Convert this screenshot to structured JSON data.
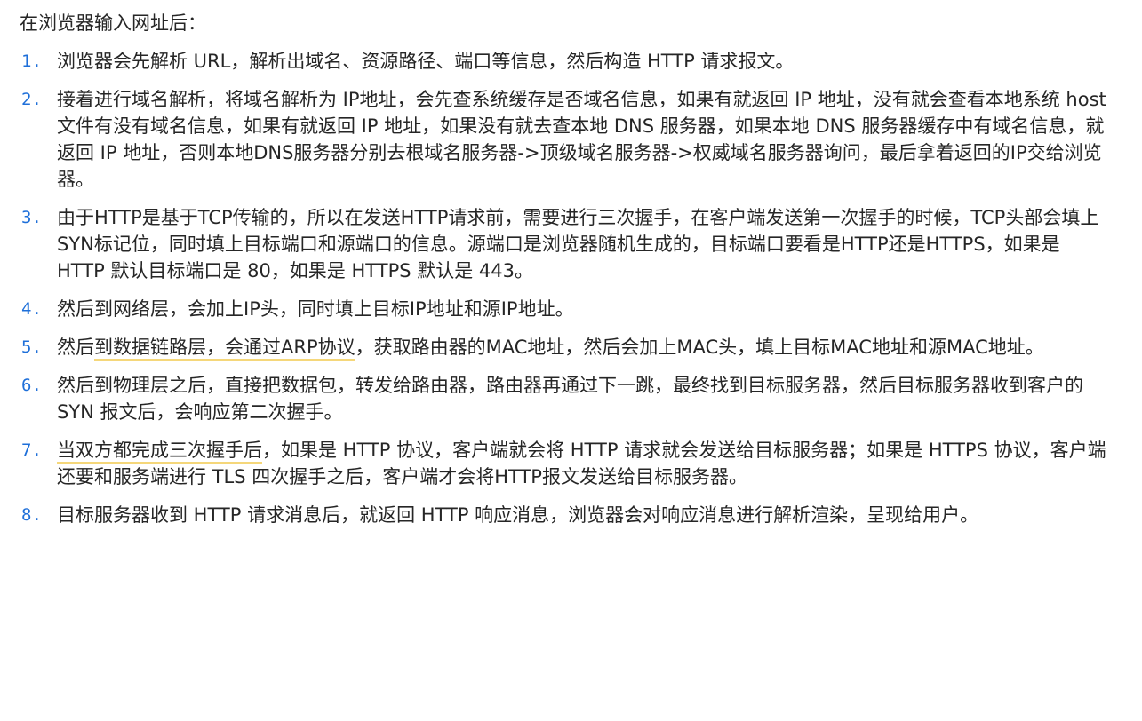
{
  "intro": "在浏览器输入网址后：",
  "steps": [
    {
      "number": "1.",
      "pre": "",
      "highlight": "",
      "text": "浏览器会先解析 URL，解析出域名、资源路径、端口等信息，然后构造 HTTP 请求报文。"
    },
    {
      "number": "2.",
      "pre": "",
      "highlight": "",
      "text": "接着进行域名解析，将域名解析为 IP地址，会先查系统缓存是否域名信息，如果有就返回 IP 地址，没有就会查看本地系统 host 文件有没有域名信息，如果有就返回 IP 地址，如果没有就去查本地 DNS 服务器，如果本地 DNS 服务器缓存中有域名信息，就返回 IP 地址，否则本地DNS服务器分别去根域名服务器->顶级域名服务器->权威域名服务器询问，最后拿着返回的IP交给浏览器。"
    },
    {
      "number": "3.",
      "pre": "",
      "highlight": "",
      "text": "由于HTTP是基于TCP传输的，所以在发送HTTP请求前，需要进行三次握手，在客户端发送第一次握手的时候，TCP头部会填上SYN标记位，同时填上目标端口和源端口的信息。源端口是浏览器随机生成的，目标端口要看是HTTP还是HTTPS，如果是 HTTP 默认目标端口是 80，如果是 HTTPS 默认是 443。"
    },
    {
      "number": "4.",
      "pre": "",
      "highlight": "",
      "text": "然后到网络层，会加上IP头，同时填上目标IP地址和源IP地址。"
    },
    {
      "number": "5.",
      "pre": "然后",
      "highlight": "到数据链路层，会通过ARP协议",
      "text": "，获取路由器的MAC地址，然后会加上MAC头，填上目标MAC地址和源MAC地址。"
    },
    {
      "number": "6.",
      "pre": "",
      "highlight": "",
      "text": "然后到物理层之后，直接把数据包，转发给路由器，路由器再通过下一跳，最终找到目标服务器，然后目标服务器收到客户的 SYN 报文后，会响应第二次握手。"
    },
    {
      "number": "7.",
      "pre": "",
      "highlight": "当双方都完成三次握手后",
      "text": "，如果是 HTTP 协议，客户端就会将 HTTP 请求就会发送给目标服务器；如果是 HTTPS 协议，客户端还要和服务端进行 TLS 四次握手之后，客户端才会将HTTP报文发送给目标服务器。"
    },
    {
      "number": "8.",
      "pre": "",
      "highlight": "",
      "text": "目标服务器收到 HTTP 请求消息后，就返回 HTTP 响应消息，浏览器会对响应消息进行解析渲染，呈现给用户。"
    }
  ],
  "colors": {
    "list_number": "#1e6fd9",
    "highlight_underline": "#f5d77a",
    "text": "#262626"
  }
}
